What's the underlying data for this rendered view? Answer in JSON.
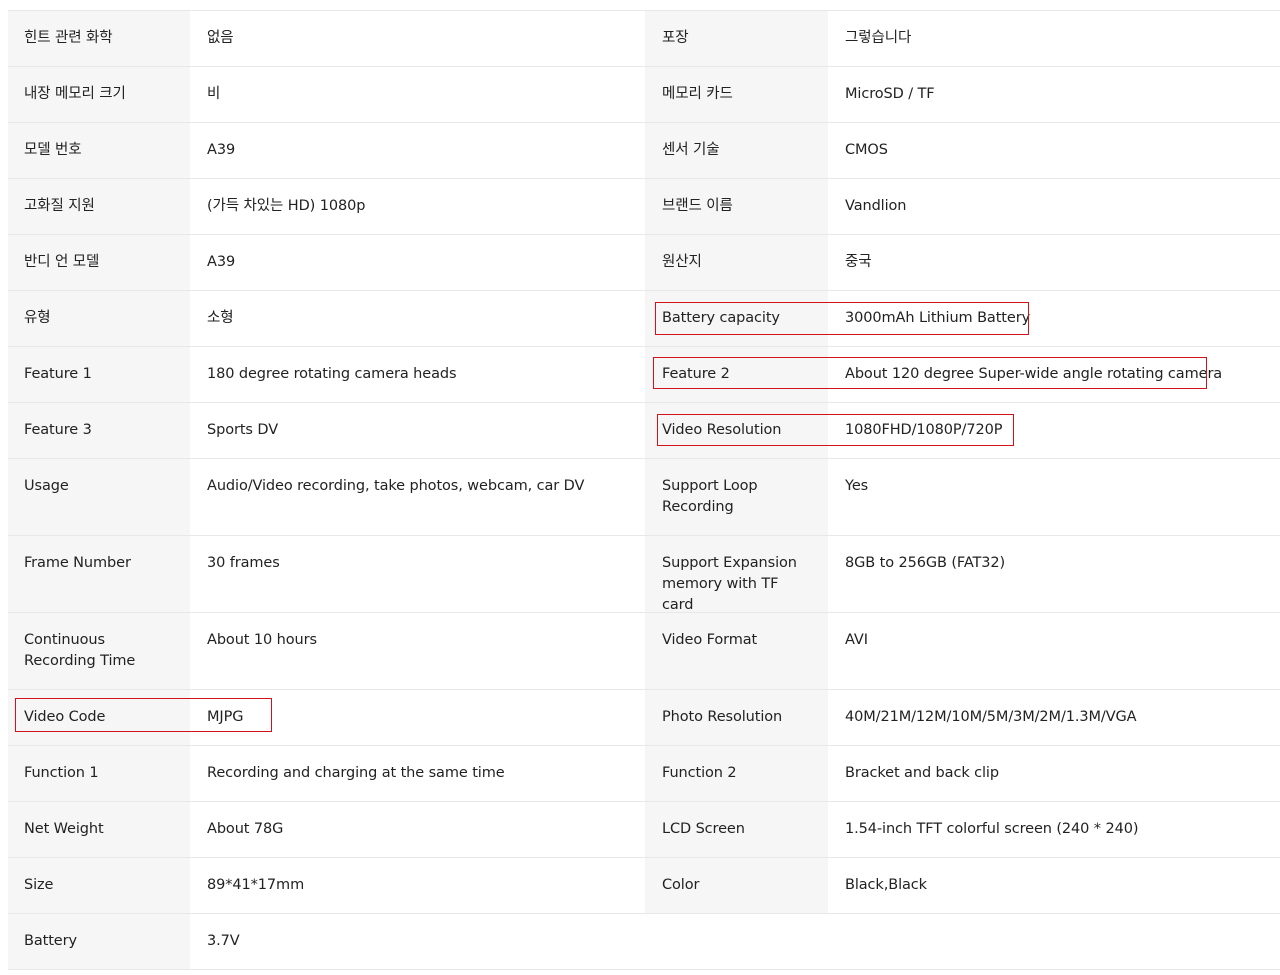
{
  "rows": [
    {
      "k1": "힌트 관련 화학",
      "v1": "없음",
      "k2": "포장",
      "v2": "그렇습니다"
    },
    {
      "k1": "내장 메모리 크기",
      "v1": "비",
      "k2": "메모리 카드",
      "v2": "MicroSD / TF"
    },
    {
      "k1": "모델 번호",
      "v1": "A39",
      "k2": "센서 기술",
      "v2": "CMOS"
    },
    {
      "k1": "고화질 지원",
      "v1": "(가득 차있는 HD) 1080p",
      "k2": "브랜드 이름",
      "v2": "Vandlion"
    },
    {
      "k1": "반디 언 모델",
      "v1": "A39",
      "k2": "원산지",
      "v2": "중국"
    },
    {
      "k1": "유형",
      "v1": "소형",
      "k2": "Battery capacity",
      "v2": "3000mAh Lithium Battery"
    },
    {
      "k1": "Feature 1",
      "v1": "180 degree rotating camera heads",
      "k2": "Feature 2",
      "v2": "About 120 degree Super-wide angle rotating camera"
    },
    {
      "k1": "Feature 3",
      "v1": "Sports DV",
      "k2": "Video Resolution",
      "v2": "1080FHD/1080P/720P"
    },
    {
      "k1": "Usage",
      "v1": "Audio/Video recording, take photos, webcam, car DV",
      "k2": "Support Loop Recording",
      "v2": "Yes"
    },
    {
      "k1": "Frame Number",
      "v1": "30 frames",
      "k2": "Support Expansion memory with TF card",
      "v2": "8GB to 256GB (FAT32)"
    },
    {
      "k1": "Continuous Recording Time",
      "v1": "About 10 hours",
      "k2": "Video Format",
      "v2": "AVI"
    },
    {
      "k1": "Video Code",
      "v1": "MJPG",
      "k2": "Photo Resolution",
      "v2": "40M/21M/12M/10M/5M/3M/2M/1.3M/VGA"
    },
    {
      "k1": "Function 1",
      "v1": "Recording and charging at the same time",
      "k2": "Function 2",
      "v2": "Bracket and back clip"
    },
    {
      "k1": "Net Weight",
      "v1": "About 78G",
      "k2": "LCD Screen",
      "v2": "1.54-inch TFT colorful screen (240 * 240)"
    },
    {
      "k1": "Size",
      "v1": "89*41*17mm",
      "k2": "Color",
      "v2": "Black,Black"
    },
    {
      "k1": "Battery",
      "v1": "3.7V"
    }
  ],
  "colors": {
    "label_bg": "#f6f6f6",
    "border": "#e8e8e8",
    "highlight": "#d0121b",
    "text": "#222222"
  }
}
